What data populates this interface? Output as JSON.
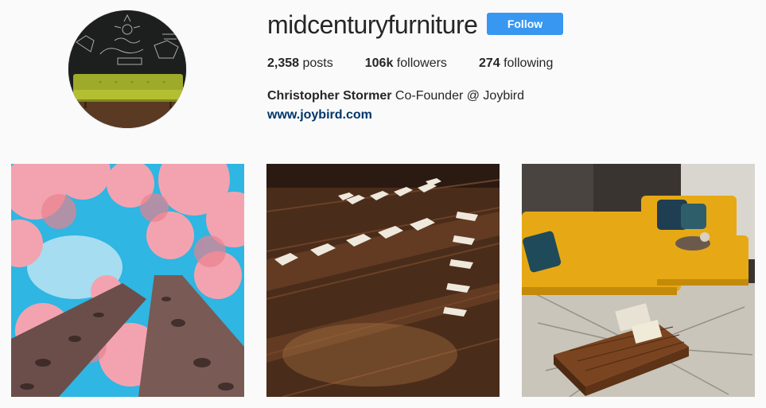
{
  "profile": {
    "username": "midcenturyfurniture",
    "follow_label": "Follow",
    "stats": {
      "posts_count": "2,358",
      "posts_label": "posts",
      "followers_count": "106k",
      "followers_label": "followers",
      "following_count": "274",
      "following_label": "following"
    },
    "bio_name": "Christopher Stormer",
    "bio_text": "Co-Founder @ Joybird",
    "website": "www.joybird.com"
  },
  "colors": {
    "follow_button": "#3897f0",
    "link": "#003569",
    "background": "#fafafa"
  },
  "posts": [
    {
      "alt": "pink-trees-photo"
    },
    {
      "alt": "wood-floor-photo"
    },
    {
      "alt": "yellow-sofa-photo"
    }
  ]
}
